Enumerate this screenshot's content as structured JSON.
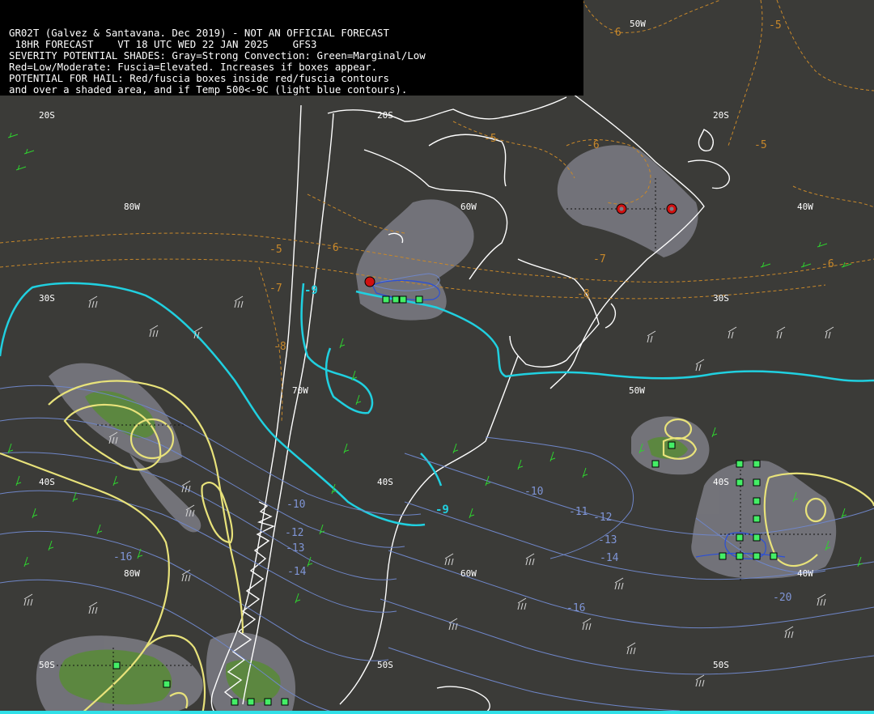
{
  "header": {
    "line1": "GR02T (Galvez & Santavana. Dec 2019) - NOT AN OFFICIAL FORECAST",
    "line2": " 18HR FORECAST    VT 18 UTC WED 22 JAN 2025    GFS3",
    "line3": "SEVERITY POTENTIAL SHADES: Gray=Strong Convection: Green=Marginal/Low",
    "line4": "Red=Low/Moderate: Fuscia=Elevated. Increases if boxes appear.",
    "line5": "POTENTIAL FOR HAIL: Red/fuscia boxes inside red/fuscia contours",
    "line6": "and over a shaded area, and if Temp 500<-9C (light blue contours)."
  },
  "grid_labels": {
    "lat_20s_a": "20S",
    "lat_20s_b": "20S",
    "lat_20s_c": "20S",
    "lon_50w_top": "50W",
    "lon_80w_a": "80W",
    "lon_60w_a": "60W",
    "lon_40w_a": "40W",
    "lat_30s_a": "30S",
    "lat_30s_b": "30S",
    "lon_70w": "70W",
    "lon_50w_b": "50W",
    "lat_40s_a": "40S",
    "lat_40s_b": "40S",
    "lat_40s_c": "40S",
    "lon_80w_b": "80W",
    "lon_60w_b": "60W",
    "lon_40w_b": "40W",
    "lat_50s_a": "50S",
    "lat_50s_b": "50S",
    "lat_50s_c": "50S"
  },
  "temperature_labels": {
    "t1": "-6",
    "t2": "-5",
    "t3": "-5",
    "t4": "-6",
    "t5": "-5",
    "t6": "-5",
    "t7": "-6",
    "t8": "-7",
    "t9": "-8",
    "t10": "-6",
    "t11": "-7",
    "t12": "-8"
  },
  "cold_labels": {
    "c1": "-9",
    "c2": "-9"
  },
  "blue_labels": {
    "b1": "-10",
    "b2": "-11",
    "b3": "-12",
    "b4": "-13",
    "b5": "-14",
    "b6": "-16",
    "b7": "-10",
    "b8": "-12",
    "b9": "-13",
    "b10": "-14",
    "b11": "-16",
    "b12": "-20"
  },
  "colors": {
    "background": "#3b3b38",
    "gray_shade": "#7d7d85",
    "green_shade": "#5a8a3a",
    "coast": "#ffffff",
    "cyan_contour": "#20d0e0",
    "blue_contour": "#7f95d6",
    "orange_contour": "#c8882a",
    "yellow_contour": "#e8e27a",
    "wind_white": "#d8d8d8",
    "wind_green": "#2fd12f",
    "box_green": "#44ee66",
    "bottom_bar": "#30e0e8"
  }
}
